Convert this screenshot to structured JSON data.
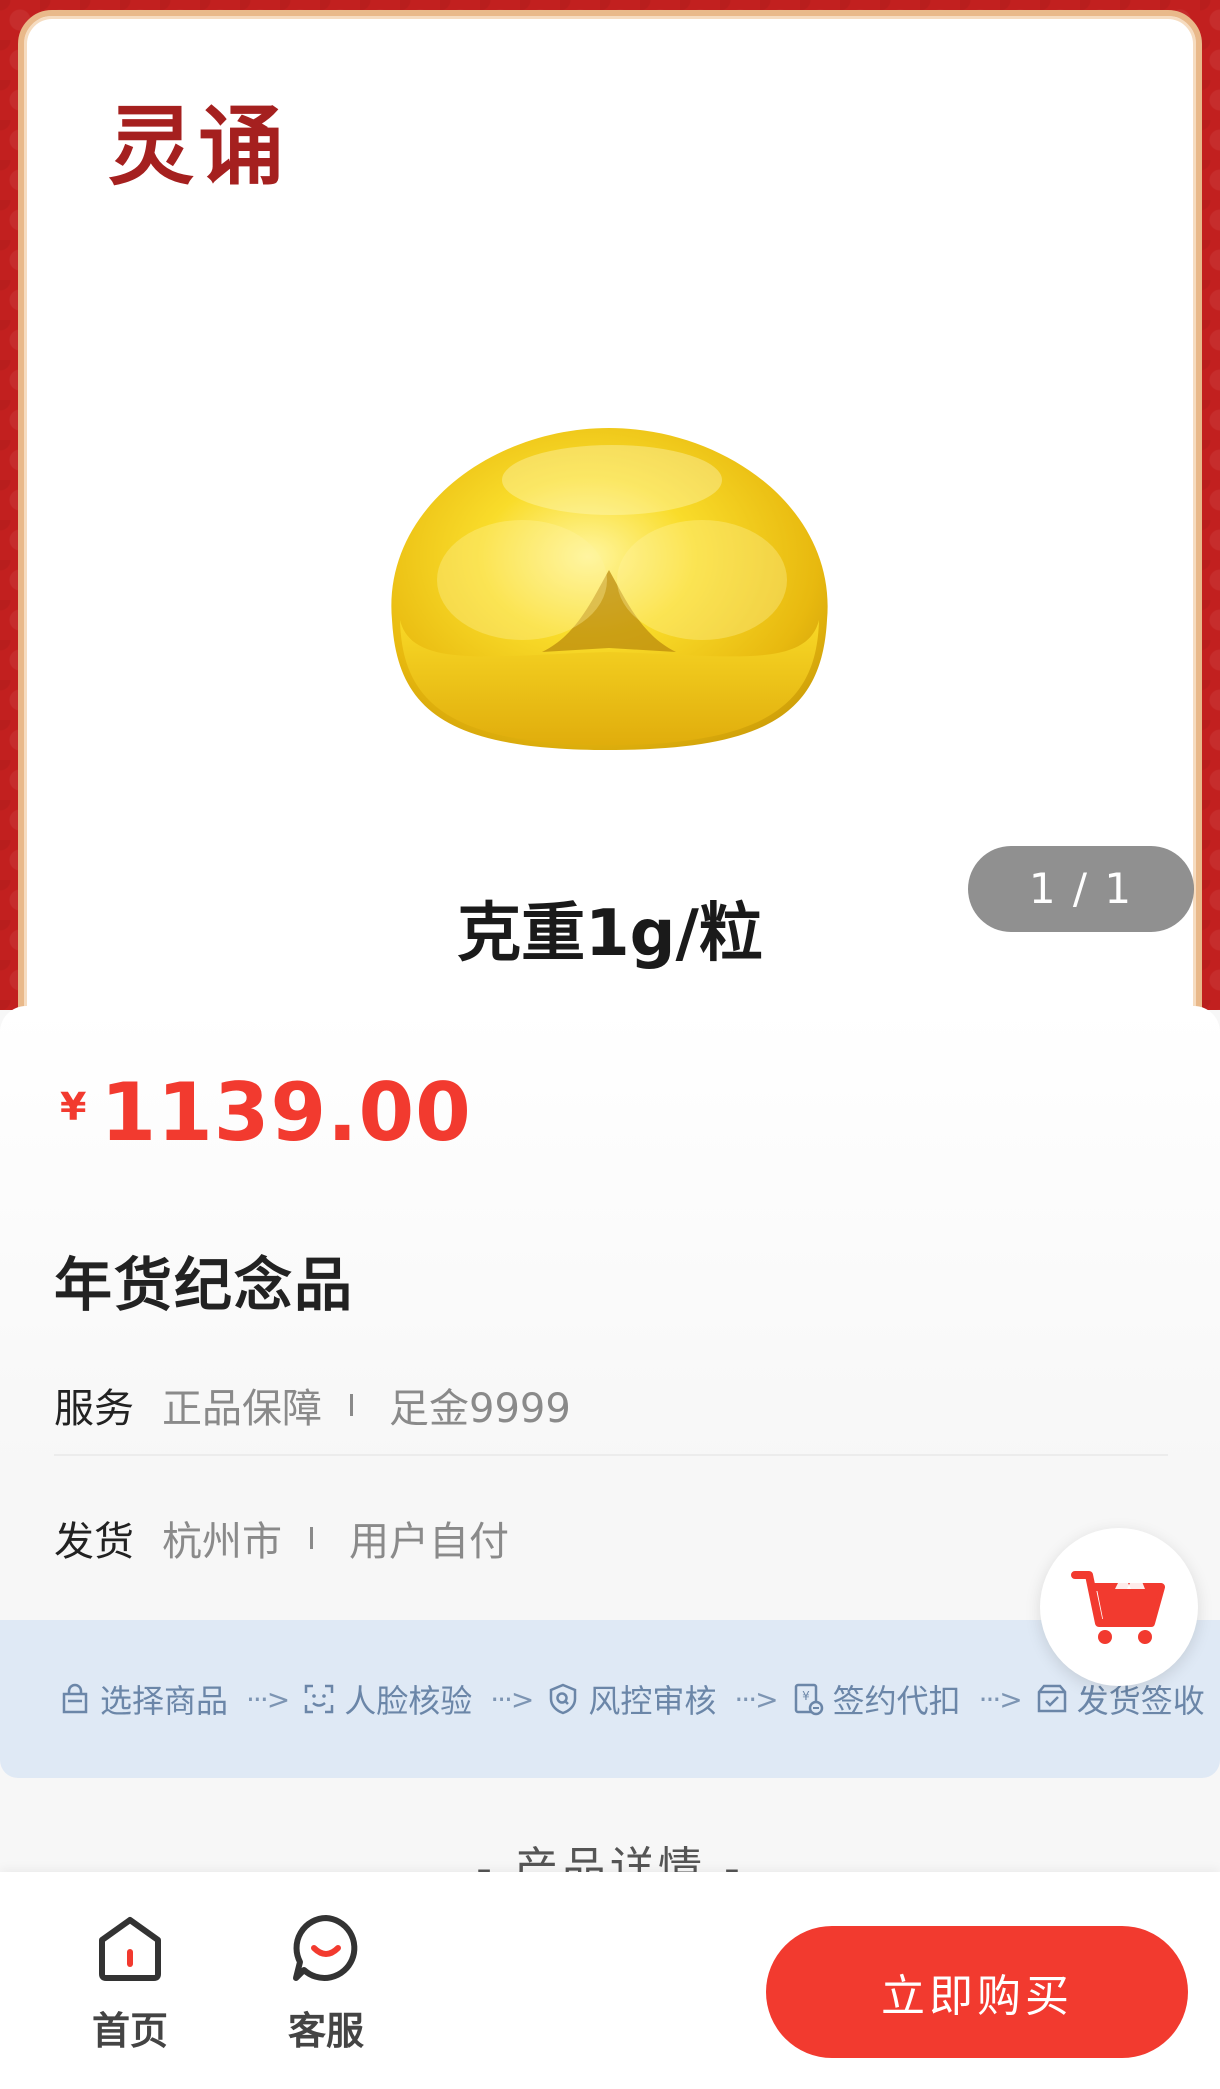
{
  "hero": {
    "brand_logo": "灵诵",
    "weight_caption": "克重1g/粒",
    "slide_indicator": "1 / 1"
  },
  "product": {
    "currency": "¥",
    "price": "1139.00",
    "title": "年货纪念品"
  },
  "specs": {
    "service_label": "服务",
    "service_values": [
      "正品保障",
      "足金9999"
    ],
    "shipping_label": "发货",
    "shipping_values": [
      "杭州市",
      "用户自付"
    ]
  },
  "process": {
    "steps": [
      "选择商品",
      "人脸核验",
      "风控审核",
      "签约代扣",
      "发货签收"
    ],
    "arrow": "···>"
  },
  "details_heading": "- 产品详情 -",
  "bottom_bar": {
    "home_label": "首页",
    "service_label": "客服",
    "buy_label": "立即购买"
  },
  "colors": {
    "accent_red": "#f23a2f",
    "banner_red": "#c2201f",
    "process_blue": "#6b86a8",
    "gold": "#f7d21c"
  },
  "icons": {
    "cart": "shopping-cart-icon",
    "home": "home-icon",
    "service": "chat-bubble-icon"
  }
}
